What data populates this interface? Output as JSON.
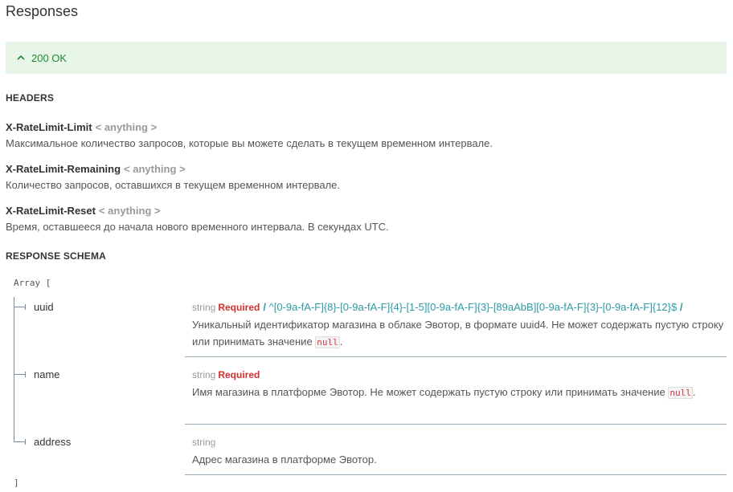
{
  "title": "Responses",
  "response": {
    "status": "200 OK",
    "expanded": true,
    "color": "#1f8c2e",
    "background": "#e8f5e9"
  },
  "headers_section": {
    "label": "HEADERS",
    "items": [
      {
        "name": "X-RateLimit-Limit",
        "type": "< anything >",
        "description": "Максимальное количество запросов, которые вы можете сделать в текущем временном интервале."
      },
      {
        "name": "X-RateLimit-Remaining",
        "type": "< anything >",
        "description": "Количество запросов, оставшихся в текущем временном интервале."
      },
      {
        "name": "X-RateLimit-Reset",
        "type": "< anything >",
        "description": "Время, оставшееся до начала нового временного интервала. В секундах UTC."
      }
    ]
  },
  "schema_section": {
    "label": "RESPONSE SCHEMA",
    "array_open": "Array [",
    "array_close": "]",
    "properties": [
      {
        "name": "uuid",
        "type": "string",
        "required": "Required",
        "pattern": "^[0-9a-fA-F]{8}-[0-9a-fA-F]{4}-[1-5][0-9a-fA-F]{3}-[89aAbB][0-9a-fA-F]{3}-[0-9a-fA-F]{12}$",
        "pattern_delim": "/",
        "description": "Уникальный идентификатор магазина в облаке Эвотор, в формате uuid4. Не может содержать пустую строку или принимать значение",
        "null_code": "null",
        "trailing": "."
      },
      {
        "name": "name",
        "type": "string",
        "required": "Required",
        "description": "Имя магазина в платформе Эвотор. Не может содержать пустую строку или принимать значение",
        "null_code": "null",
        "trailing": "."
      },
      {
        "name": "address",
        "type": "string",
        "description": "Адрес магазина в платформе Эвотор."
      }
    ]
  }
}
